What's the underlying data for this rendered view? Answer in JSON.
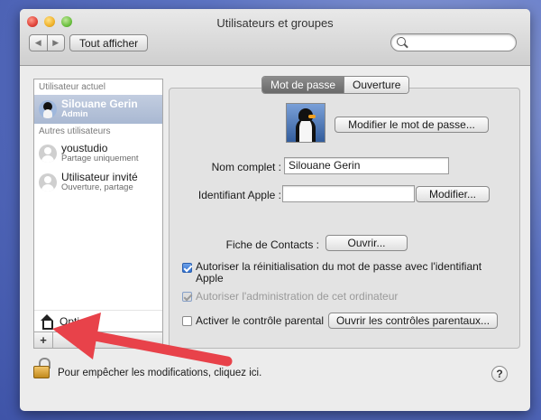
{
  "window": {
    "title": "Utilisateurs et groupes"
  },
  "toolbar": {
    "back": "◀",
    "forward": "▶",
    "show_all": "Tout afficher",
    "search_placeholder": ""
  },
  "sidebar": {
    "current_header": "Utilisateur actuel",
    "current_user": {
      "name": "Silouane Gerin",
      "role": "Admin"
    },
    "others_header": "Autres utilisateurs",
    "others": [
      {
        "name": "youstudio",
        "role": "Partage uniquement"
      },
      {
        "name": "Utilisateur invité",
        "role": "Ouverture, partage"
      }
    ],
    "options": "Options",
    "add": "+"
  },
  "tabs": [
    "Mot de passe",
    "Ouverture"
  ],
  "form": {
    "change_password": "Modifier le mot de passe...",
    "full_name_label": "Nom complet :",
    "full_name_value": "Silouane Gerin",
    "apple_id_label": "Identifiant Apple :",
    "apple_id_value": "",
    "modify": "Modifier...",
    "contacts_label": "Fiche de Contacts :",
    "open": "Ouvrir...",
    "allow_reset": "Autoriser la réinitialisation du mot de passe avec l'identifiant Apple",
    "allow_admin": "Autoriser l'administration de cet ordinateur",
    "parental_label": "Activer le contrôle parental",
    "open_parental": "Ouvrir les contrôles parentaux..."
  },
  "footer": {
    "lock_text": "Pour empêcher les modifications, cliquez ici.",
    "help": "?"
  },
  "colors": {
    "arrow": "#e8424a",
    "selection": "#a9b8d2",
    "desktop": "#5d74c4"
  }
}
